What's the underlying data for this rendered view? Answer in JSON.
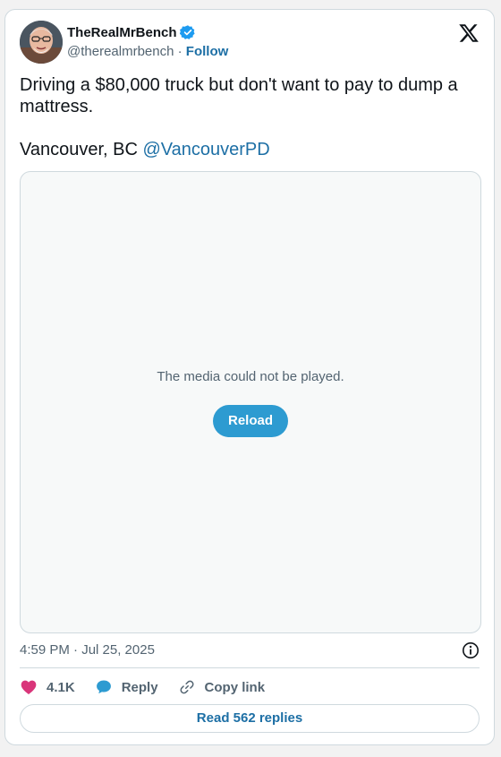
{
  "user": {
    "display_name": "TheRealMrBench",
    "handle": "@therealmrbench",
    "separator": " · ",
    "follow_label": "Follow",
    "avatar_icon": "avatar-photo"
  },
  "tweet": {
    "line1": "Driving a $80,000 truck but don't want to pay to dump a mattress.",
    "line2_prefix": "Vancouver, BC ",
    "mention": "@VancouverPD"
  },
  "media": {
    "message": "The media could not be played.",
    "reload_label": "Reload"
  },
  "meta": {
    "timestamp": "4:59 PM · Jul 25, 2025"
  },
  "actions": {
    "like_count": "4.1K",
    "reply_label": "Reply",
    "copy_label": "Copy link"
  },
  "footer": {
    "read_replies_label": "Read 562 replies"
  },
  "colors": {
    "accent": "#1d6fa5",
    "reload_bg": "#2d9bd1",
    "like": "#f91880",
    "verified": "#1d9bf0"
  }
}
